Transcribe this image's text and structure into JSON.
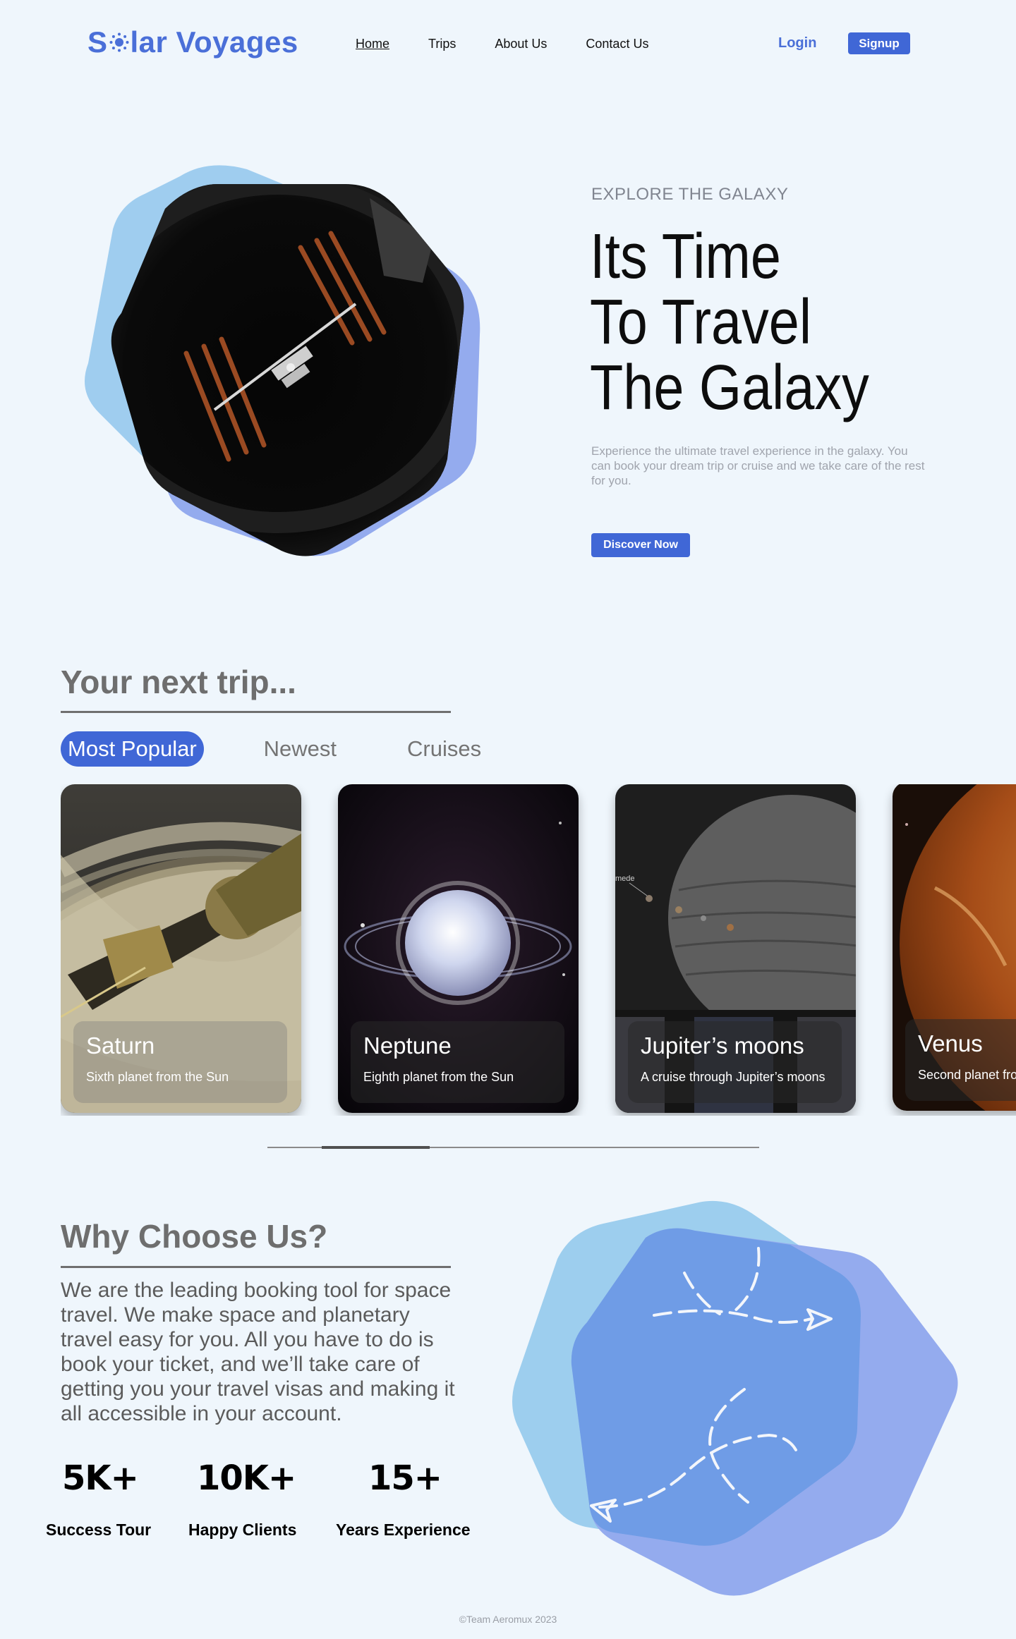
{
  "brand": {
    "name_prefix": "S",
    "name_suffix": "lar Voyages",
    "accent": "#4067d6"
  },
  "nav": {
    "items": [
      {
        "label": "Home",
        "active": true
      },
      {
        "label": "Trips",
        "active": false
      },
      {
        "label": "About Us",
        "active": false
      },
      {
        "label": "Contact Us",
        "active": false
      }
    ],
    "login": "Login",
    "signup": "Signup"
  },
  "hero": {
    "eyebrow": "EXPLORE THE GALAXY",
    "title_lines": [
      "Its Time",
      "To Travel",
      "The Galaxy"
    ],
    "description": "Experience the ultimate travel experience in the galaxy. You can book your dream trip or cruise and we take care of the rest for you.",
    "cta": "Discover Now"
  },
  "trips": {
    "heading": "Your next trip...",
    "tabs": [
      {
        "label": "Most Popular",
        "active": true
      },
      {
        "label": "Newest",
        "active": false
      },
      {
        "label": "Cruises",
        "active": false
      }
    ],
    "cards": [
      {
        "name": "Saturn",
        "description": "Sixth planet from the Sun",
        "image": "saturn-cassini-image"
      },
      {
        "name": "Neptune",
        "description": "Eighth planet from the Sun",
        "image": "neptune-rings-image"
      },
      {
        "name": "Jupiter’s moons",
        "description": "A cruise through Jupiter’s moons",
        "image": "jupiter-moons-image",
        "image_label": "mede"
      },
      {
        "name": "Venus",
        "description": "Second planet from the Sun",
        "image": "venus-surface-image"
      }
    ],
    "slider_position": 0.22
  },
  "why": {
    "heading": "Why Choose Us?",
    "text": "We are the leading booking tool for space travel. We make space and planetary travel easy for you. All you have to do is book your ticket, and we’ll take care of getting you your travel visas and making it all accessible in your account.",
    "stats": [
      {
        "value": "5K+",
        "label": "Success Tour"
      },
      {
        "value": "10K+",
        "label": "Happy Clients"
      },
      {
        "value": "15+",
        "label": "Years Experience"
      }
    ]
  },
  "footer": {
    "copyright": "©Team Aeromux 2023"
  }
}
